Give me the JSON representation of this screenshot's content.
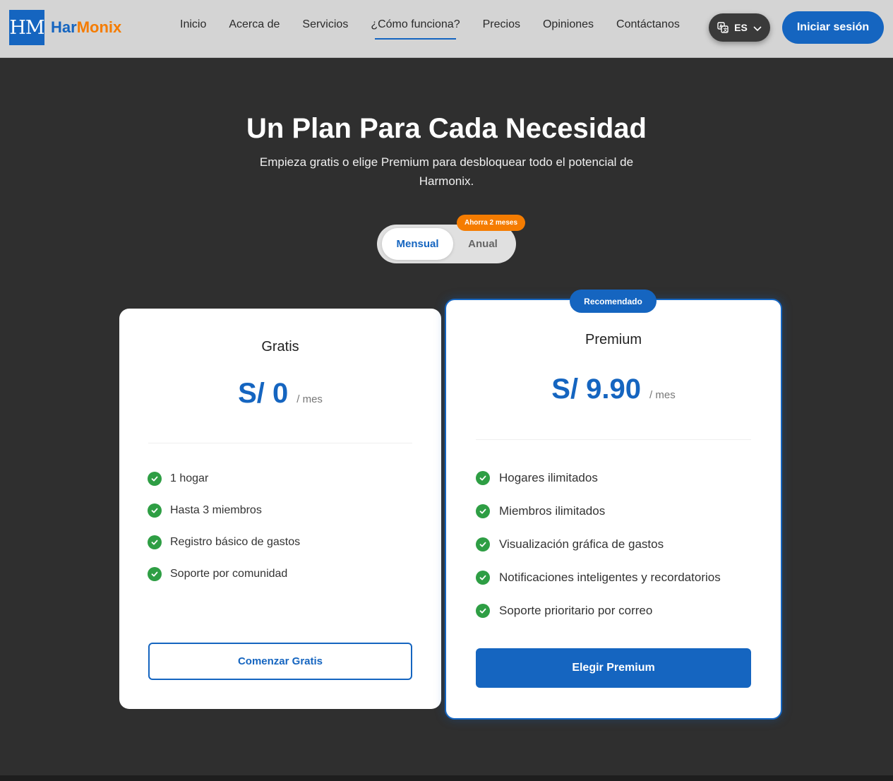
{
  "brand": {
    "logo_mark": "HM",
    "name_part1": "Har",
    "name_part2": "Monix"
  },
  "nav": {
    "items": [
      {
        "label": "Inicio"
      },
      {
        "label": "Acerca de"
      },
      {
        "label": "Servicios"
      },
      {
        "label": "¿Cómo funciona?",
        "active": true
      },
      {
        "label": "Precios"
      },
      {
        "label": "Opiniones"
      },
      {
        "label": "Contáctanos"
      }
    ]
  },
  "header": {
    "language": "ES",
    "language_icon": "translate-icon",
    "login_label": "Iniciar sesión"
  },
  "hero": {
    "title": "Un Plan Para Cada Necesidad",
    "subtitle": "Empieza gratis o elige Premium para desbloquear todo el potencial de Harmonix."
  },
  "billing_toggle": {
    "monthly": "Mensual",
    "annual": "Anual",
    "selected": "Mensual",
    "save_badge": "Ahorra 2 meses"
  },
  "plans": [
    {
      "name": "Gratis",
      "price": "S/ 0",
      "period": "/ mes",
      "features": [
        "1 hogar",
        "Hasta 3 miembros",
        "Registro básico de gastos",
        "Soporte por comunidad"
      ],
      "cta": "Comenzar Gratis"
    },
    {
      "name": "Premium",
      "badge": "Recomendado",
      "price": "S/ 9.90",
      "period": "/ mes",
      "features": [
        "Hogares ilimitados",
        "Miembros ilimitados",
        "Visualización gráfica de gastos",
        "Notificaciones inteligentes y recordatorios",
        "Soporte prioritario por correo"
      ],
      "cta": "Elegir Premium"
    }
  ],
  "colors": {
    "primary": "#1565c0",
    "accent": "#f57c00",
    "check": "#2e9e44",
    "background": "#2f2f2f",
    "header_bg": "#d4d4d4"
  }
}
